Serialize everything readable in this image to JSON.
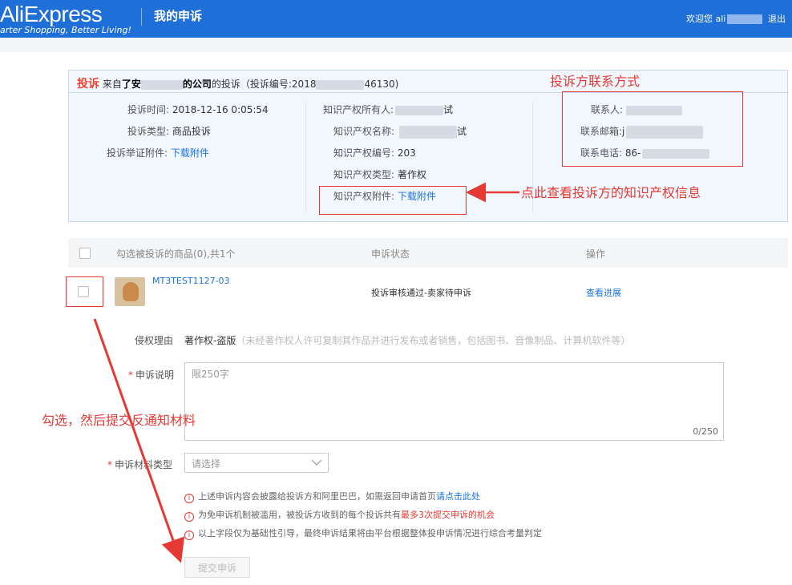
{
  "header": {
    "logo": "AliExpress",
    "slogan": "arter Shopping, Better Living!",
    "page_title": "我的申诉",
    "welcome": "欢迎您 ali",
    "logout": "退出"
  },
  "complaint": {
    "tag": "投诉",
    "from_prefix": "来自",
    "from_company_start": "了安",
    "from_company_end": "的公司",
    "complaint_suffix": "的投诉（投诉编号:2018",
    "id_end": "46130)",
    "left": {
      "time_label": "投诉时间:",
      "time_value": "2018-12-16 0:05:54",
      "type_label": "投诉类型:",
      "type_value": "商品投诉",
      "evidence_label": "投诉举证附件:",
      "evidence_link": "下载附件"
    },
    "middle": {
      "owner_label": "知识产权所有人:",
      "owner_value_end": "试",
      "ip_name_label": "知识产权名称:",
      "ip_name_value_end": "试",
      "ip_no_label": "知识产权编号:",
      "ip_no_value": "203",
      "ip_type_label": "知识产权类型:",
      "ip_type_value": "著作权",
      "ip_attach_label": "知识产权附件:",
      "ip_attach_link": "下载附件"
    },
    "right": {
      "contact_label": "联系人:",
      "email_label": "联系邮箱:",
      "email_value_start": "j",
      "phone_label": "联系电话:",
      "phone_value_start": "86-"
    }
  },
  "annotations": {
    "contact_info": "投诉方联系方式",
    "ip_info": "点此查看投诉方的知识产权信息",
    "select_submit": "勾选，然后提交反通知材料"
  },
  "table": {
    "headers": [
      "勾选被投诉的商品(0),共1个",
      "申诉状态",
      "操作"
    ],
    "rows": [
      {
        "product": "MT3TEST1127-03",
        "status": "投诉审核通过-卖家待申诉",
        "action": "查看进展"
      }
    ]
  },
  "form": {
    "reason_label": "侵权理由",
    "reason_value": "著作权-盗版",
    "reason_desc": "（未经著作权人许可复制其作品并进行发布或者销售，包括图书、音像制品、计算机软件等）",
    "desc_label": "申诉说明",
    "desc_placeholder": "限250字",
    "desc_counter": "0/250",
    "material_label": "申诉材料类型",
    "material_placeholder": "请选择",
    "notices": [
      {
        "text": "上述申诉内容会披露给投诉方和阿里巴巴，如需返回申请首页",
        "highlight": "请点击此处"
      },
      {
        "text": "为免申诉机制被滥用，被投诉方收到的每个投诉共有",
        "highlight": "最多3次提交申诉的机会"
      },
      {
        "text": "以上字段仅为基础性引导，最终申诉结果将由平台根据整体投申诉情况进行综合考量判定",
        "highlight": ""
      }
    ],
    "submit": "提交申诉"
  },
  "colors": {
    "header_bg": "#1f6fd8",
    "link": "#1a73d9",
    "annotation_red": "#e53935",
    "card_bg": "#f2f7fd"
  }
}
